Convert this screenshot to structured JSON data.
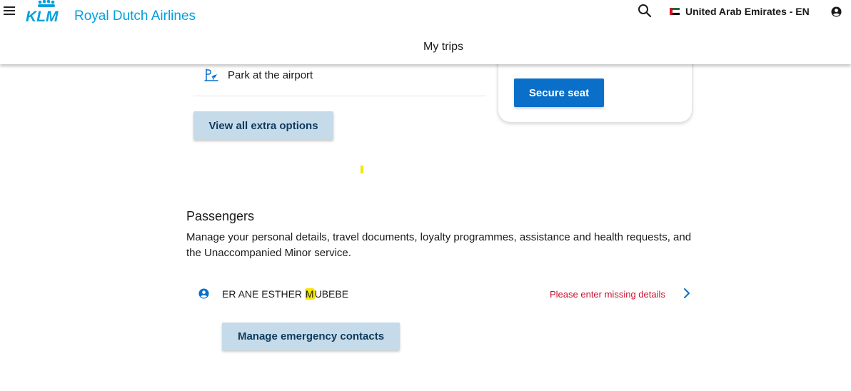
{
  "header": {
    "brand_logo_text": "KLM",
    "brand_name": "Royal Dutch Airlines",
    "locale_label": "United Arab Emirates - EN",
    "page_title": "My trips",
    "icons": [
      "menu-icon",
      "search-icon",
      "uae-flag-icon",
      "account-icon"
    ]
  },
  "extras": {
    "items": [
      {
        "label": "Park at the airport",
        "icon": "parking-icon"
      }
    ],
    "view_all_label": "View all extra options"
  },
  "seat_card": {
    "button_label": "Secure seat"
  },
  "passengers": {
    "title": "Passengers",
    "description": "Manage your personal details, travel documents, loyalty programmes, assistance and health requests, and the Unaccompanied Minor service.",
    "list": [
      {
        "name_before": "ER ANE ESTHER ",
        "name_highlight": "M",
        "name_after": "UBEBE",
        "status": "Please enter missing details"
      }
    ],
    "emergency_button_label": "Manage emergency contacts"
  },
  "colors": {
    "brand_blue": "#00a1de",
    "primary_button": "#0a6fc9",
    "secondary_button": "#c5dbe9",
    "secondary_button_text": "#0e3a5f",
    "error_text": "#c8102e",
    "highlight": "#f7e600"
  }
}
